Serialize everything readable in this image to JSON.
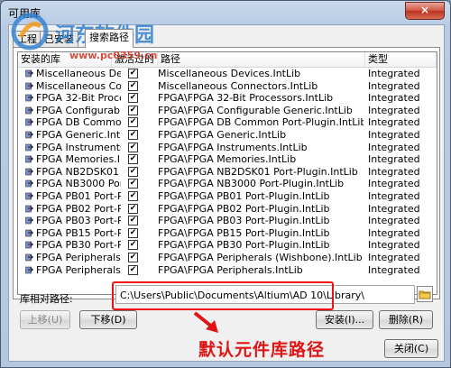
{
  "window": {
    "title": "可用库",
    "close_glyph": "×"
  },
  "watermark": {
    "name": "河东软件园",
    "url": "www.pc0359.cn"
  },
  "tabs": [
    {
      "label": "工程"
    },
    {
      "label": "已安装"
    },
    {
      "label": "搜索路径"
    }
  ],
  "table": {
    "headers": {
      "name": "安装的库",
      "activated": "激活过的",
      "path": "路径",
      "type": "类型"
    },
    "rows": [
      {
        "name": "Miscellaneous Devices",
        "activated": true,
        "path": "Miscellaneous Devices.IntLib",
        "type": "Integrated"
      },
      {
        "name": "Miscellaneous Connectors",
        "activated": true,
        "path": "Miscellaneous Connectors.IntLib",
        "type": "Integrated"
      },
      {
        "name": "FPGA 32-Bit Processors",
        "activated": true,
        "path": "FPGA\\FPGA 32-Bit Processors.IntLib",
        "type": "Integrated"
      },
      {
        "name": "FPGA Configurable Generic",
        "activated": true,
        "path": "FPGA\\FPGA Configurable Generic.IntLib",
        "type": "Integrated"
      },
      {
        "name": "FPGA DB Common Port-Plugin",
        "activated": true,
        "path": "FPGA\\FPGA DB Common Port-Plugin.IntLib",
        "type": "Integrated"
      },
      {
        "name": "FPGA Generic.IntLib",
        "activated": true,
        "path": "FPGA\\FPGA Generic.IntLib",
        "type": "Integrated"
      },
      {
        "name": "FPGA Instruments.IntLib",
        "activated": true,
        "path": "FPGA\\FPGA Instruments.IntLib",
        "type": "Integrated"
      },
      {
        "name": "FPGA Memories.IntLib",
        "activated": true,
        "path": "FPGA\\FPGA Memories.IntLib",
        "type": "Integrated"
      },
      {
        "name": "FPGA NB2DSK01 Port-Plugin",
        "activated": true,
        "path": "FPGA\\FPGA NB2DSK01 Port-Plugin.IntLib",
        "type": "Integrated"
      },
      {
        "name": "FPGA NB3000 Port-Plugin",
        "activated": true,
        "path": "FPGA\\FPGA NB3000 Port-Plugin.IntLib",
        "type": "Integrated"
      },
      {
        "name": "FPGA PB01 Port-Plugin",
        "activated": true,
        "path": "FPGA\\FPGA PB01 Port-Plugin.IntLib",
        "type": "Integrated"
      },
      {
        "name": "FPGA PB02 Port-Plugin",
        "activated": true,
        "path": "FPGA\\FPGA PB02 Port-Plugin.IntLib",
        "type": "Integrated"
      },
      {
        "name": "FPGA PB03 Port-Plugin",
        "activated": true,
        "path": "FPGA\\FPGA PB03 Port-Plugin.IntLib",
        "type": "Integrated"
      },
      {
        "name": "FPGA PB15 Port-Plugin",
        "activated": true,
        "path": "FPGA\\FPGA PB15 Port-Plugin.IntLib",
        "type": "Integrated"
      },
      {
        "name": "FPGA PB30 Port-Plugin",
        "activated": true,
        "path": "FPGA\\FPGA PB30 Port-Plugin.IntLib",
        "type": "Integrated"
      },
      {
        "name": "FPGA Peripherals (Wishbone)",
        "activated": true,
        "path": "FPGA\\FPGA Peripherals (Wishbone).IntLib",
        "type": "Integrated"
      },
      {
        "name": "FPGA Peripherals.IntLib",
        "activated": true,
        "path": "FPGA\\FPGA Peripherals.IntLib",
        "type": "Integrated"
      }
    ]
  },
  "library_path": {
    "label": "库相对路径:",
    "value": "C:\\Users\\Public\\Documents\\Altium\\AD 10\\Library\\"
  },
  "buttons": {
    "move_up": "上移(U)",
    "move_down": "下移(D)",
    "install": "安装(I)...",
    "remove": "删除(R)",
    "close": "关闭(C)"
  },
  "annotation": "默认元件库路径",
  "colors": {
    "annotation": "#e01414",
    "highlight_frame": "#e11111"
  }
}
